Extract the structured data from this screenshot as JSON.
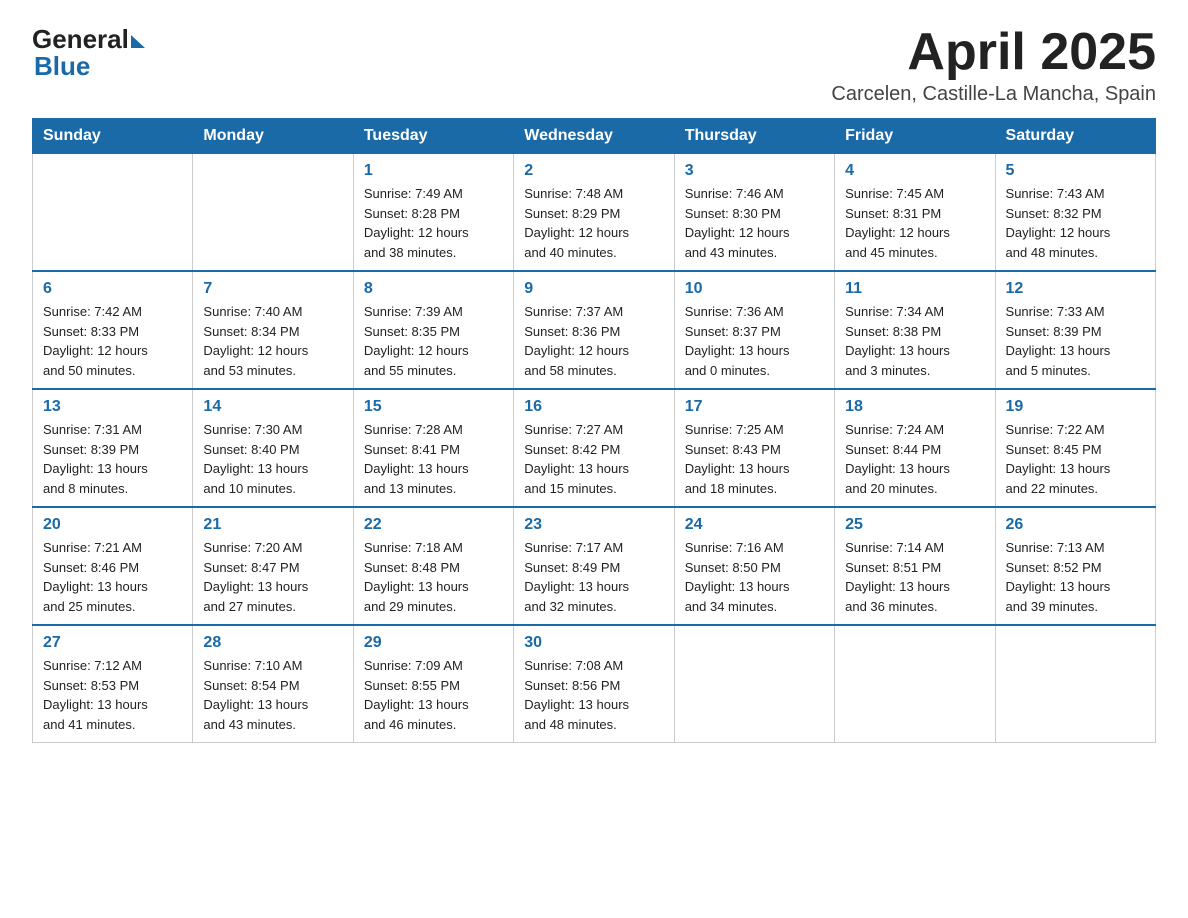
{
  "header": {
    "logo_general": "General",
    "logo_blue": "Blue",
    "title": "April 2025",
    "location": "Carcelen, Castille-La Mancha, Spain"
  },
  "days_of_week": [
    "Sunday",
    "Monday",
    "Tuesday",
    "Wednesday",
    "Thursday",
    "Friday",
    "Saturday"
  ],
  "weeks": [
    [
      {
        "day": "",
        "info": ""
      },
      {
        "day": "",
        "info": ""
      },
      {
        "day": "1",
        "info": "Sunrise: 7:49 AM\nSunset: 8:28 PM\nDaylight: 12 hours\nand 38 minutes."
      },
      {
        "day": "2",
        "info": "Sunrise: 7:48 AM\nSunset: 8:29 PM\nDaylight: 12 hours\nand 40 minutes."
      },
      {
        "day": "3",
        "info": "Sunrise: 7:46 AM\nSunset: 8:30 PM\nDaylight: 12 hours\nand 43 minutes."
      },
      {
        "day": "4",
        "info": "Sunrise: 7:45 AM\nSunset: 8:31 PM\nDaylight: 12 hours\nand 45 minutes."
      },
      {
        "day": "5",
        "info": "Sunrise: 7:43 AM\nSunset: 8:32 PM\nDaylight: 12 hours\nand 48 minutes."
      }
    ],
    [
      {
        "day": "6",
        "info": "Sunrise: 7:42 AM\nSunset: 8:33 PM\nDaylight: 12 hours\nand 50 minutes."
      },
      {
        "day": "7",
        "info": "Sunrise: 7:40 AM\nSunset: 8:34 PM\nDaylight: 12 hours\nand 53 minutes."
      },
      {
        "day": "8",
        "info": "Sunrise: 7:39 AM\nSunset: 8:35 PM\nDaylight: 12 hours\nand 55 minutes."
      },
      {
        "day": "9",
        "info": "Sunrise: 7:37 AM\nSunset: 8:36 PM\nDaylight: 12 hours\nand 58 minutes."
      },
      {
        "day": "10",
        "info": "Sunrise: 7:36 AM\nSunset: 8:37 PM\nDaylight: 13 hours\nand 0 minutes."
      },
      {
        "day": "11",
        "info": "Sunrise: 7:34 AM\nSunset: 8:38 PM\nDaylight: 13 hours\nand 3 minutes."
      },
      {
        "day": "12",
        "info": "Sunrise: 7:33 AM\nSunset: 8:39 PM\nDaylight: 13 hours\nand 5 minutes."
      }
    ],
    [
      {
        "day": "13",
        "info": "Sunrise: 7:31 AM\nSunset: 8:39 PM\nDaylight: 13 hours\nand 8 minutes."
      },
      {
        "day": "14",
        "info": "Sunrise: 7:30 AM\nSunset: 8:40 PM\nDaylight: 13 hours\nand 10 minutes."
      },
      {
        "day": "15",
        "info": "Sunrise: 7:28 AM\nSunset: 8:41 PM\nDaylight: 13 hours\nand 13 minutes."
      },
      {
        "day": "16",
        "info": "Sunrise: 7:27 AM\nSunset: 8:42 PM\nDaylight: 13 hours\nand 15 minutes."
      },
      {
        "day": "17",
        "info": "Sunrise: 7:25 AM\nSunset: 8:43 PM\nDaylight: 13 hours\nand 18 minutes."
      },
      {
        "day": "18",
        "info": "Sunrise: 7:24 AM\nSunset: 8:44 PM\nDaylight: 13 hours\nand 20 minutes."
      },
      {
        "day": "19",
        "info": "Sunrise: 7:22 AM\nSunset: 8:45 PM\nDaylight: 13 hours\nand 22 minutes."
      }
    ],
    [
      {
        "day": "20",
        "info": "Sunrise: 7:21 AM\nSunset: 8:46 PM\nDaylight: 13 hours\nand 25 minutes."
      },
      {
        "day": "21",
        "info": "Sunrise: 7:20 AM\nSunset: 8:47 PM\nDaylight: 13 hours\nand 27 minutes."
      },
      {
        "day": "22",
        "info": "Sunrise: 7:18 AM\nSunset: 8:48 PM\nDaylight: 13 hours\nand 29 minutes."
      },
      {
        "day": "23",
        "info": "Sunrise: 7:17 AM\nSunset: 8:49 PM\nDaylight: 13 hours\nand 32 minutes."
      },
      {
        "day": "24",
        "info": "Sunrise: 7:16 AM\nSunset: 8:50 PM\nDaylight: 13 hours\nand 34 minutes."
      },
      {
        "day": "25",
        "info": "Sunrise: 7:14 AM\nSunset: 8:51 PM\nDaylight: 13 hours\nand 36 minutes."
      },
      {
        "day": "26",
        "info": "Sunrise: 7:13 AM\nSunset: 8:52 PM\nDaylight: 13 hours\nand 39 minutes."
      }
    ],
    [
      {
        "day": "27",
        "info": "Sunrise: 7:12 AM\nSunset: 8:53 PM\nDaylight: 13 hours\nand 41 minutes."
      },
      {
        "day": "28",
        "info": "Sunrise: 7:10 AM\nSunset: 8:54 PM\nDaylight: 13 hours\nand 43 minutes."
      },
      {
        "day": "29",
        "info": "Sunrise: 7:09 AM\nSunset: 8:55 PM\nDaylight: 13 hours\nand 46 minutes."
      },
      {
        "day": "30",
        "info": "Sunrise: 7:08 AM\nSunset: 8:56 PM\nDaylight: 13 hours\nand 48 minutes."
      },
      {
        "day": "",
        "info": ""
      },
      {
        "day": "",
        "info": ""
      },
      {
        "day": "",
        "info": ""
      }
    ]
  ]
}
